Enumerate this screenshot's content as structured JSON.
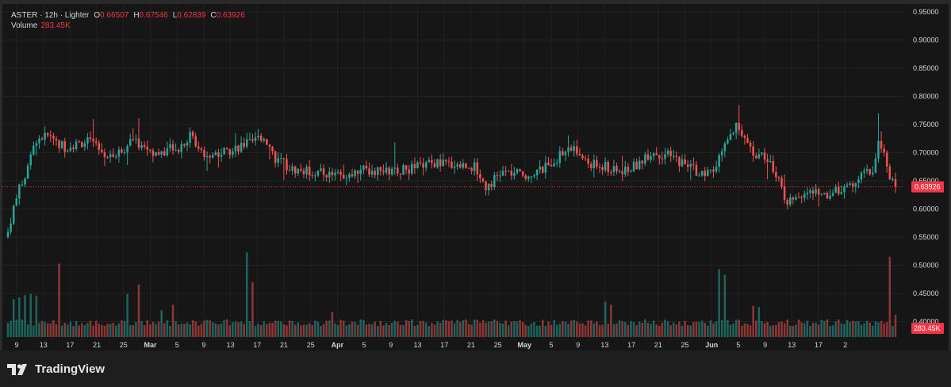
{
  "legend": {
    "symbol_line": "ASTER · 12h · Lighter",
    "o_label": "O",
    "o_value": "0.66507",
    "h_label": "H",
    "h_value": "0.67546",
    "l_label": "L",
    "l_value": "0.62839",
    "c_label": "C",
    "c_value": "0.63926",
    "volume_label": "Volume",
    "volume_value": "283.45K"
  },
  "brand": {
    "name": "TradingView"
  },
  "colors": {
    "up": "#26a69a",
    "down": "#ef5350",
    "background": "#161616",
    "grid": "#222222",
    "axis_text": "#d1d4dc",
    "price_badge": "#f23645"
  },
  "chart_data": {
    "type": "candlestick",
    "interval": "12h",
    "ylim": [
      0.52,
      0.96
    ],
    "y_ticks": [
      0.55,
      0.6,
      0.65,
      0.7,
      0.75,
      0.8,
      0.85,
      0.9,
      0.95
    ],
    "y_tick_labels": [
      "0.55000",
      "0.60000",
      "0.65000",
      "0.70000",
      "0.75000",
      "0.80000",
      "0.85000",
      "0.90000",
      "0.95000"
    ],
    "volume_y_ticks": [
      0.4,
      0.45,
      0.5
    ],
    "volume_y_tick_labels": [
      "0.40000",
      "0.45000",
      "0.50000"
    ],
    "x_ticks": [
      {
        "label": "9",
        "bold": false
      },
      {
        "label": "13",
        "bold": false
      },
      {
        "label": "17",
        "bold": false
      },
      {
        "label": "21",
        "bold": false
      },
      {
        "label": "25",
        "bold": false
      },
      {
        "label": "Mar",
        "bold": true
      },
      {
        "label": "5",
        "bold": false
      },
      {
        "label": "9",
        "bold": false
      },
      {
        "label": "13",
        "bold": false
      },
      {
        "label": "17",
        "bold": false
      },
      {
        "label": "21",
        "bold": false
      },
      {
        "label": "25",
        "bold": false
      },
      {
        "label": "Apr",
        "bold": true
      },
      {
        "label": "5",
        "bold": false
      },
      {
        "label": "9",
        "bold": false
      },
      {
        "label": "13",
        "bold": false
      },
      {
        "label": "17",
        "bold": false
      },
      {
        "label": "21",
        "bold": false
      },
      {
        "label": "25",
        "bold": false
      },
      {
        "label": "May",
        "bold": true
      },
      {
        "label": "5",
        "bold": false
      },
      {
        "label": "9",
        "bold": false
      },
      {
        "label": "13",
        "bold": false
      },
      {
        "label": "17",
        "bold": false
      },
      {
        "label": "21",
        "bold": false
      },
      {
        "label": "25",
        "bold": false
      },
      {
        "label": "Jun",
        "bold": true
      },
      {
        "label": "5",
        "bold": false
      },
      {
        "label": "9",
        "bold": false
      },
      {
        "label": "13",
        "bold": false
      },
      {
        "label": "17",
        "bold": false
      },
      {
        "label": "2",
        "bold": false
      }
    ],
    "last_price": 0.63926,
    "last_price_label": "0.63926",
    "last_volume_label": "283.45K",
    "close_keypoints": [
      [
        0,
        0.56
      ],
      [
        3,
        0.625
      ],
      [
        6,
        0.655
      ],
      [
        10,
        0.725
      ],
      [
        14,
        0.73
      ],
      [
        20,
        0.71
      ],
      [
        28,
        0.72
      ],
      [
        36,
        0.69
      ],
      [
        44,
        0.72
      ],
      [
        52,
        0.7
      ],
      [
        60,
        0.71
      ],
      [
        64,
        0.73
      ],
      [
        70,
        0.695
      ],
      [
        78,
        0.705
      ],
      [
        86,
        0.72
      ],
      [
        90,
        0.73
      ],
      [
        94,
        0.69
      ],
      [
        100,
        0.67
      ],
      [
        108,
        0.665
      ],
      [
        116,
        0.66
      ],
      [
        124,
        0.67
      ],
      [
        132,
        0.665
      ],
      [
        140,
        0.67
      ],
      [
        148,
        0.68
      ],
      [
        156,
        0.68
      ],
      [
        164,
        0.675
      ],
      [
        168,
        0.64
      ],
      [
        174,
        0.665
      ],
      [
        182,
        0.66
      ],
      [
        188,
        0.67
      ],
      [
        194,
        0.695
      ],
      [
        198,
        0.71
      ],
      [
        204,
        0.68
      ],
      [
        210,
        0.675
      ],
      [
        214,
        0.665
      ],
      [
        220,
        0.675
      ],
      [
        226,
        0.7
      ],
      [
        232,
        0.695
      ],
      [
        236,
        0.685
      ],
      [
        240,
        0.675
      ],
      [
        244,
        0.66
      ],
      [
        248,
        0.665
      ],
      [
        252,
        0.71
      ],
      [
        256,
        0.745
      ],
      [
        258,
        0.73
      ],
      [
        262,
        0.7
      ],
      [
        266,
        0.69
      ],
      [
        270,
        0.665
      ],
      [
        274,
        0.61
      ],
      [
        278,
        0.625
      ],
      [
        284,
        0.63
      ],
      [
        288,
        0.625
      ],
      [
        292,
        0.635
      ],
      [
        296,
        0.64
      ],
      [
        300,
        0.66
      ],
      [
        304,
        0.67
      ],
      [
        306,
        0.72
      ],
      [
        308,
        0.7
      ],
      [
        310,
        0.66
      ],
      [
        312,
        0.63926
      ]
    ],
    "volume_spikes": [
      [
        2,
        0.44
      ],
      [
        4,
        0.443
      ],
      [
        6,
        0.447
      ],
      [
        8,
        0.449
      ],
      [
        10,
        0.446
      ],
      [
        18,
        0.503
      ],
      [
        42,
        0.449
      ],
      [
        46,
        0.466
      ],
      [
        54,
        0.42
      ],
      [
        58,
        0.43
      ],
      [
        84,
        0.523
      ],
      [
        86,
        0.47
      ],
      [
        114,
        0.417
      ],
      [
        210,
        0.435
      ],
      [
        212,
        0.43
      ],
      [
        250,
        0.493
      ],
      [
        252,
        0.483
      ],
      [
        262,
        0.428
      ],
      [
        264,
        0.426
      ],
      [
        310,
        0.515
      ],
      [
        312,
        0.412
      ]
    ]
  }
}
